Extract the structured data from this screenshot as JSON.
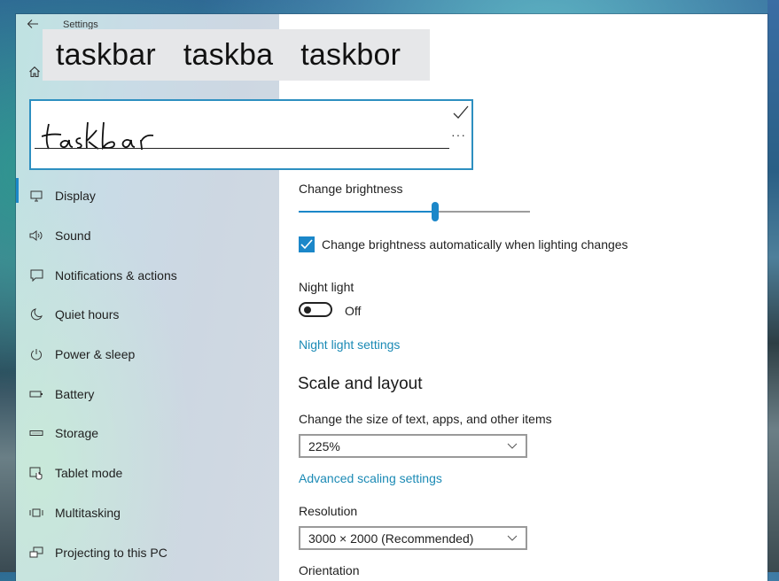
{
  "window": {
    "title": "Settings",
    "back_icon": "back-arrow-icon",
    "controls": {
      "minimize": "minimize-icon",
      "maximize": "maximize-icon",
      "close": "close-icon"
    }
  },
  "sidebar": {
    "home_icon": "home-icon",
    "items": [
      {
        "label": "Display",
        "icon": "monitor-icon",
        "active": true
      },
      {
        "label": "Sound",
        "icon": "speaker-icon",
        "active": false
      },
      {
        "label": "Notifications & actions",
        "icon": "notification-icon",
        "active": false
      },
      {
        "label": "Quiet hours",
        "icon": "moon-icon",
        "active": false
      },
      {
        "label": "Power & sleep",
        "icon": "power-icon",
        "active": false
      },
      {
        "label": "Battery",
        "icon": "battery-icon",
        "active": false
      },
      {
        "label": "Storage",
        "icon": "storage-icon",
        "active": false
      },
      {
        "label": "Tablet mode",
        "icon": "tablet-mode-icon",
        "active": false
      },
      {
        "label": "Multitasking",
        "icon": "multitasking-icon",
        "active": false
      },
      {
        "label": "Projecting to this PC",
        "icon": "projecting-icon",
        "active": false
      }
    ]
  },
  "handwriting": {
    "suggestions": [
      "taskbar",
      "taskba",
      "taskbor"
    ],
    "ink_text": "taskbar",
    "accept_icon": "checkmark-icon",
    "more_icon": "more-dots-icon",
    "more_label": "···"
  },
  "content": {
    "brightness": {
      "label": "Change brightness",
      "value_percent": 59
    },
    "auto_brightness": {
      "label": "Change brightness automatically when lighting changes",
      "checked": true
    },
    "night_light": {
      "label": "Night light",
      "state": "Off",
      "on": false,
      "settings_link": "Night light settings"
    },
    "scale_layout": {
      "heading": "Scale and layout",
      "size_label": "Change the size of text, apps, and other items",
      "size_value": "225%",
      "advanced_link": "Advanced scaling settings",
      "resolution_label": "Resolution",
      "resolution_value": "3000 × 2000 (Recommended)",
      "orientation_label": "Orientation"
    }
  },
  "colors": {
    "accent": "#1b87c9",
    "link": "#1b8ab5"
  }
}
